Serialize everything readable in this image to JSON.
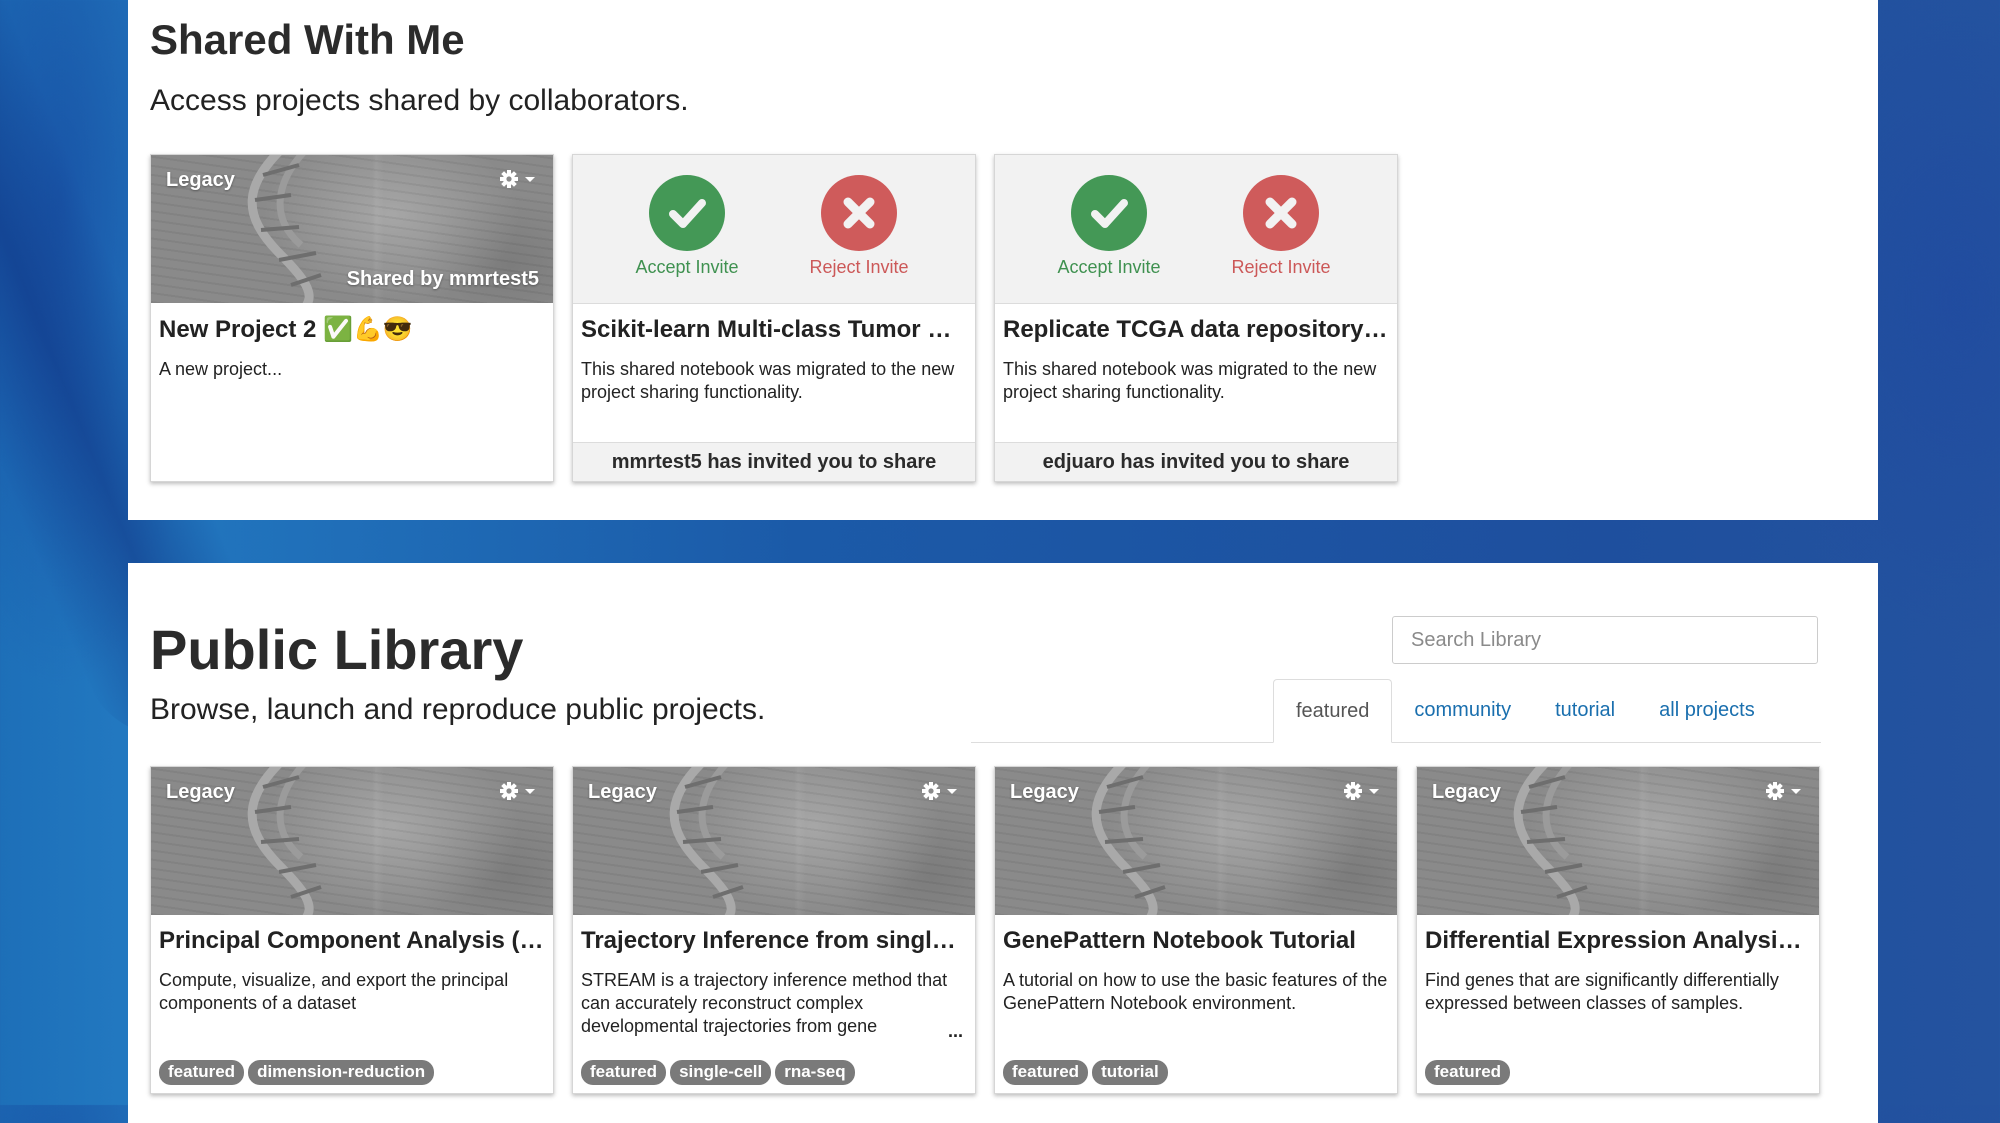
{
  "shared_section": {
    "title": "Shared With Me",
    "subtitle": "Access projects shared by collaborators.",
    "cards": [
      {
        "type": "project",
        "badge": "Legacy",
        "menu_icon": "gear-icon",
        "shared_by": "Shared by mmrtest5",
        "title": "New Project 2 ✅💪😎",
        "description": "A new project..."
      },
      {
        "type": "invite",
        "accept_label": "Accept Invite",
        "reject_label": "Reject Invite",
        "title": "Scikit-learn Multi-class Tumor Cla...",
        "description": "This shared notebook was migrated to the new project sharing functionality.",
        "footer": "mmrtest5 has invited you to share"
      },
      {
        "type": "invite",
        "accept_label": "Accept Invite",
        "reject_label": "Reject Invite",
        "title": "Replicate TCGA data repository w...",
        "description": "This shared notebook was migrated to the new project sharing functionality.",
        "footer": "edjuaro has invited you to share"
      }
    ]
  },
  "library_section": {
    "title": "Public Library",
    "subtitle": "Browse, launch and reproduce public projects.",
    "search": {
      "placeholder": "Search Library",
      "value": ""
    },
    "tabs": [
      {
        "label": "featured",
        "active": true
      },
      {
        "label": "community",
        "active": false
      },
      {
        "label": "tutorial",
        "active": false
      },
      {
        "label": "all projects",
        "active": false
      }
    ],
    "cards": [
      {
        "badge": "Legacy",
        "title": "Principal Component Analysis (PCA)",
        "description": "Compute, visualize, and export the principal components of a dataset",
        "tags": [
          "featured",
          "dimension-reduction"
        ]
      },
      {
        "badge": "Legacy",
        "title": "Trajectory Inference from single-c...",
        "description": "STREAM is a trajectory inference method that can accurately reconstruct complex developmental trajectories from gene",
        "more": "...",
        "tags": [
          "featured",
          "single-cell",
          "rna-seq"
        ]
      },
      {
        "badge": "Legacy",
        "title": "GenePattern Notebook Tutorial",
        "description": "A tutorial on how to use the basic features of the GenePattern Notebook environment.",
        "tags": [
          "featured",
          "tutorial"
        ]
      },
      {
        "badge": "Legacy",
        "title": "Differential Expression Analysis - ...",
        "description": "Find genes that are significantly differentially expressed between classes of samples.",
        "tags": [
          "featured"
        ]
      }
    ]
  },
  "colors": {
    "accept": "#449856",
    "reject": "#cf5b5b",
    "tab_link": "#1a6fae",
    "tag": "#7a7a7a",
    "background": "#1e5aa6"
  }
}
